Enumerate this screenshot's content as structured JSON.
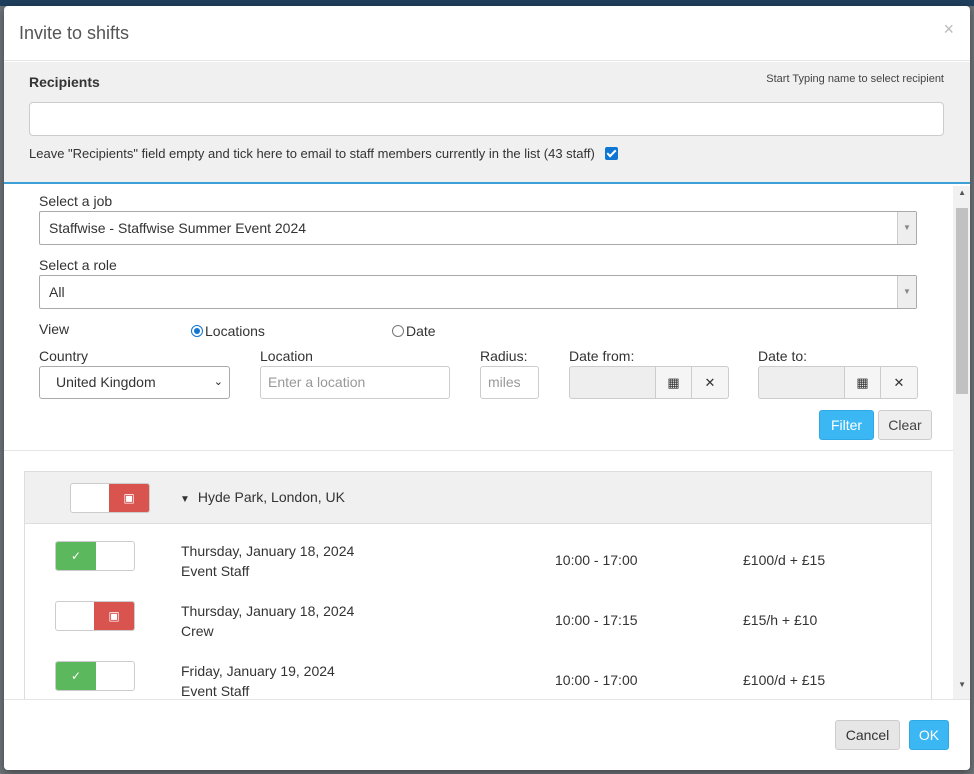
{
  "modal": {
    "title": "Invite to shifts",
    "close_glyph": "×"
  },
  "recipients": {
    "label": "Recipients",
    "hint": "Start Typing name to select recipient",
    "value": "",
    "tick_text": "Leave \"Recipients\" field empty and tick here to email to staff members currently in the list (43 staff)",
    "tick_checked": true
  },
  "filters": {
    "job_label": "Select a job",
    "job_value": "Staffwise - Staffwise Summer Event 2024",
    "role_label": "Select a role",
    "role_value": "All",
    "view_label": "View",
    "view_locations": "Locations",
    "view_date": "Date",
    "view_selected": "Locations",
    "country_label": "Country",
    "country_value": "United Kingdom",
    "location_label": "Location",
    "location_placeholder": "Enter a location",
    "radius_label": "Radius:",
    "radius_placeholder": "miles",
    "date_from_label": "Date from:",
    "date_to_label": "Date to:",
    "date_from_value": "",
    "date_to_value": "",
    "filter_button": "Filter",
    "clear_button": "Clear"
  },
  "location_group": {
    "name": "Hyde Park, London, UK",
    "toggle_state": "off",
    "shifts": [
      {
        "date": "Thursday, January 18, 2024",
        "role": "Event Staff",
        "time": "10:00 - 17:00",
        "pay": "£100/d + £15",
        "toggle_state": "on"
      },
      {
        "date": "Thursday, January 18, 2024",
        "role": "Crew",
        "time": "10:00 - 17:15",
        "pay": "£15/h + £10",
        "toggle_state": "off"
      },
      {
        "date": "Friday, January 19, 2024",
        "role": "Event Staff",
        "time": "10:00 - 17:00",
        "pay": "£100/d + £15",
        "toggle_state": "on"
      }
    ]
  },
  "footer": {
    "cancel": "Cancel",
    "ok": "OK"
  },
  "colors": {
    "primary": "#3bb8f3",
    "success": "#5cb85c",
    "danger": "#d9534f",
    "checkbox": "#0f76d4"
  },
  "icons": {
    "calendar": "calendar-icon",
    "clear": "times-icon",
    "check": "check-icon",
    "briefcase": "briefcase-icon",
    "caret": "caret-down-icon"
  }
}
